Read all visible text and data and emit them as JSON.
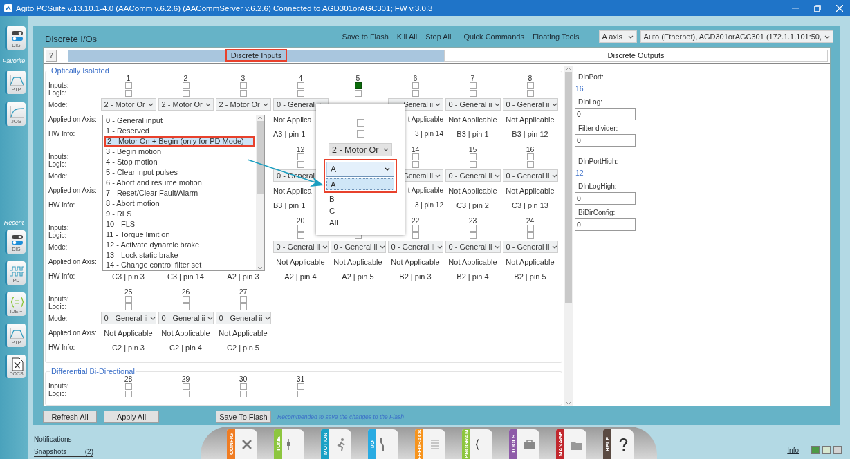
{
  "window": {
    "title": "Agito PCSuite v.13.10.1-4.0 (AAComm v.6.2.6) (AACommServer v.6.2.6) Connected to AGD301orAGC301; FW v.3.0.3"
  },
  "sidebar": {
    "top": [
      {
        "label": "DIG",
        "kind": "dig"
      }
    ],
    "favorite_heading": "Favorite",
    "favorites": [
      {
        "label": "PTP",
        "kind": "ptp"
      },
      {
        "label": "JOG",
        "kind": "jog"
      }
    ],
    "recent_heading": "Recent",
    "recent": [
      {
        "label": "DIG",
        "kind": "dig"
      },
      {
        "label": "PD",
        "kind": "pd"
      },
      {
        "label": "IDE +",
        "kind": "ide"
      },
      {
        "label": "PTP",
        "kind": "ptp"
      },
      {
        "label": "DOCS",
        "kind": "docs"
      }
    ]
  },
  "page": {
    "title": "Discrete I/Os",
    "toolbar": [
      "Save to Flash",
      "Kill All",
      "Stop All",
      "Quick Commands",
      "Floating Tools"
    ],
    "axis_select": "A axis",
    "connection_select": "Auto (Ethernet), AGD301orAGC301 (172.1.1.101:50,"
  },
  "help_button": "?",
  "tabs": [
    {
      "label": "Discrete Inputs",
      "selected": true,
      "highlighted": true
    },
    {
      "label": "Discrete Outputs",
      "selected": false,
      "highlighted": false
    }
  ],
  "groups": [
    {
      "title": "Optically Isolated",
      "blocks": [
        {
          "labels": {
            "inputs": "Inputs:",
            "logic": "Logic:",
            "mode": "Mode:",
            "axis": "Applied on Axis:",
            "hw": "HW Info:"
          },
          "columns": [
            {
              "number": "1",
              "input": false,
              "logic": false,
              "mode": "2 - Motor Or"
            },
            {
              "number": "2",
              "input": false,
              "logic": false,
              "mode": "2 - Motor Or"
            },
            {
              "number": "3",
              "input": false,
              "logic": false,
              "mode": "2 - Motor Or"
            },
            {
              "number": "4",
              "input": false,
              "logic": false,
              "mode": "0 - General",
              "axis": "Not Applica",
              "hw": "A3 | pin 1"
            },
            {
              "number": "5",
              "input": true,
              "logic": false
            },
            {
              "number": "6",
              "input": false,
              "logic": false,
              "mode": "General ii",
              "axis": "t Applicable",
              "hw": "3 | pin 14"
            },
            {
              "number": "7",
              "input": false,
              "logic": false,
              "mode": "0 - General ii",
              "axis": "Not Applicable",
              "hw": "B3 | pin 1"
            },
            {
              "number": "8",
              "input": false,
              "logic": false,
              "mode": "0 - General ii",
              "axis": "Not Applicable",
              "hw": "B3 | pin 12"
            }
          ]
        },
        {
          "labels": {
            "inputs": "Inputs:",
            "logic": "Logic:",
            "mode": "Mode:",
            "axis": "Applied on Axis:",
            "hw": "HW Info:"
          },
          "columns": [
            {},
            {},
            {},
            {
              "number": "12",
              "input": false,
              "logic": false,
              "mode": "0 - General",
              "axis": "Not Applica",
              "hw": "B3 | pin 1"
            },
            {},
            {
              "number": "14",
              "input": false,
              "logic": false,
              "mode": "General ii",
              "axis": "t Applicable",
              "hw": "3 | pin 12"
            },
            {
              "number": "15",
              "input": false,
              "logic": false,
              "mode": "0 - General ii",
              "axis": "Not Applicable",
              "hw": "C3 | pin 2"
            },
            {
              "number": "16",
              "input": false,
              "logic": false,
              "mode": "0 - General ii",
              "axis": "Not Applicable",
              "hw": "C3 | pin 13"
            }
          ]
        },
        {
          "labels": {
            "inputs": "Inputs:",
            "logic": "Logic:",
            "mode": "Mode:",
            "axis": "Applied on Axis:",
            "hw": "HW Info:"
          },
          "columns": [
            {
              "hw": "C3 | pin 3"
            },
            {
              "hw": "C3 | pin 14"
            },
            {
              "hw": "A2 | pin 3"
            },
            {
              "number": "20",
              "input": false,
              "logic": false,
              "mode": "0 - General ii",
              "axis": "Not Applicable",
              "hw": "A2 | pin 4"
            },
            {
              "logic": false,
              "mode": "0 - General ii",
              "axis": "Not Applicable",
              "hw": "A2 | pin 5"
            },
            {
              "number": "22",
              "input": false,
              "logic": false,
              "mode": "0 - General ii",
              "axis": "Not Applicable",
              "hw": "B2 | pin 3"
            },
            {
              "number": "23",
              "input": false,
              "logic": false,
              "mode": "0 - General ii",
              "axis": "Not Applicable",
              "hw": "B2 | pin 4"
            },
            {
              "number": "24",
              "input": false,
              "logic": false,
              "mode": "0 - General ii",
              "axis": "Not Applicable",
              "hw": "B2 | pin 5"
            }
          ]
        },
        {
          "labels": {
            "inputs": "Inputs:",
            "logic": "Logic:",
            "mode": "Mode:",
            "axis": "Applied on Axis:",
            "hw": "HW Info:"
          },
          "columns": [
            {
              "number": "25",
              "input": false,
              "logic": false,
              "mode": "0 - General ii",
              "axis": "Not Applicable",
              "hw": "C2 | pin 3"
            },
            {
              "number": "26",
              "input": false,
              "logic": false,
              "mode": "0 - General ii",
              "axis": "Not Applicable",
              "hw": "C2 | pin 4"
            },
            {
              "number": "27",
              "input": false,
              "logic": false,
              "mode": "0 - General ii",
              "axis": "Not Applicable",
              "hw": "C2 | pin 5"
            }
          ]
        }
      ]
    },
    {
      "title": "Differential Bi-Directional",
      "blocks": [
        {
          "labels": {
            "inputs": "Inputs:",
            "logic": "Logic:"
          },
          "columns": [
            {
              "number": "28",
              "input": false,
              "logic": false
            },
            {
              "number": "29",
              "input": false,
              "logic": false
            },
            {
              "number": "30",
              "input": false,
              "logic": false
            },
            {
              "number": "31",
              "input": false,
              "logic": false
            }
          ]
        }
      ]
    }
  ],
  "properties": [
    {
      "label": "DInPort:",
      "kind": "value",
      "value": "16"
    },
    {
      "label": "DInLog:",
      "kind": "field",
      "value": "0"
    },
    {
      "label": "Filter divider:",
      "kind": "field",
      "value": "0"
    },
    {
      "label": "DInPortHigh:",
      "kind": "value",
      "value": "12"
    },
    {
      "label": "DInLogHigh:",
      "kind": "field",
      "value": "0"
    },
    {
      "label": "BiDirConfig:",
      "kind": "field",
      "value": "0"
    }
  ],
  "buttons": [
    "Refresh All",
    "Apply All",
    "Save To Flash"
  ],
  "note": "Recommended to save the changes to the Flash",
  "mode_dropdown": {
    "options": [
      {
        "label": "0 - General input",
        "selected": false,
        "highlighted": false
      },
      {
        "label": "1 - Reserved",
        "selected": false,
        "highlighted": false
      },
      {
        "label": "2 - Motor On + Begin (only for PD Mode)",
        "selected": true,
        "highlighted": true
      },
      {
        "label": "3 - Begin motion",
        "selected": false,
        "highlighted": false
      },
      {
        "label": "4 - Stop motion",
        "selected": false,
        "highlighted": false
      },
      {
        "label": "5 - Clear input pulses",
        "selected": false,
        "highlighted": false
      },
      {
        "label": "6 - Abort and resume motion",
        "selected": false,
        "highlighted": false
      },
      {
        "label": "7 - Reset/Clear Fault/Alarm",
        "selected": false,
        "highlighted": false
      },
      {
        "label": "8 - Abort motion",
        "selected": false,
        "highlighted": false
      },
      {
        "label": "9 - RLS",
        "selected": false,
        "highlighted": false
      },
      {
        "label": "10 - FLS",
        "selected": false,
        "highlighted": false
      },
      {
        "label": "11 - Torque limit on",
        "selected": false,
        "highlighted": false
      },
      {
        "label": "12 - Activate dynamic brake",
        "selected": false,
        "highlighted": false
      },
      {
        "label": "13 - Lock static brake",
        "selected": false,
        "highlighted": false
      },
      {
        "label": "14 - Change control filter set",
        "selected": false,
        "highlighted": false
      }
    ]
  },
  "axis_popup": {
    "input": false,
    "logic": false,
    "mode": "2 - Motor Or",
    "axis_select": "A",
    "highlighted": true,
    "options": [
      {
        "label": "A",
        "selected": true
      },
      {
        "label": "B",
        "selected": false
      },
      {
        "label": "C",
        "selected": false
      },
      {
        "label": "All",
        "selected": false
      }
    ]
  },
  "bottom_links": {
    "notifications": "Notifications",
    "snapshots": "Snapshots",
    "snapshots_count": "(2)"
  },
  "dock": [
    {
      "label": "CONFIG",
      "kind": "tools",
      "color": "#f07c22"
    },
    {
      "label": "TUNE",
      "kind": "scale",
      "color": "#8dc63f"
    },
    {
      "label": "MOTION",
      "kind": "runner",
      "color": "#1ba1c5"
    },
    {
      "label": "I/O",
      "kind": "switch",
      "color": "#29abe2"
    },
    {
      "label": "FEEDBACK",
      "kind": "list",
      "color": "#f7941d"
    },
    {
      "label": "PROGRAM",
      "kind": "code",
      "color": "#8dc63f"
    },
    {
      "label": "TOOLS",
      "kind": "case",
      "color": "#8e5ba8"
    },
    {
      "label": "MANAGE",
      "kind": "folder",
      "color": "#c1272d"
    },
    {
      "label": "HELP",
      "kind": "help",
      "color": "#5a4a42"
    }
  ],
  "info_link": "Info",
  "indicators": [
    {
      "color": "#4d9a45"
    },
    {
      "color": "#d7e8d0"
    },
    {
      "color": "#d3d3d3"
    }
  ]
}
